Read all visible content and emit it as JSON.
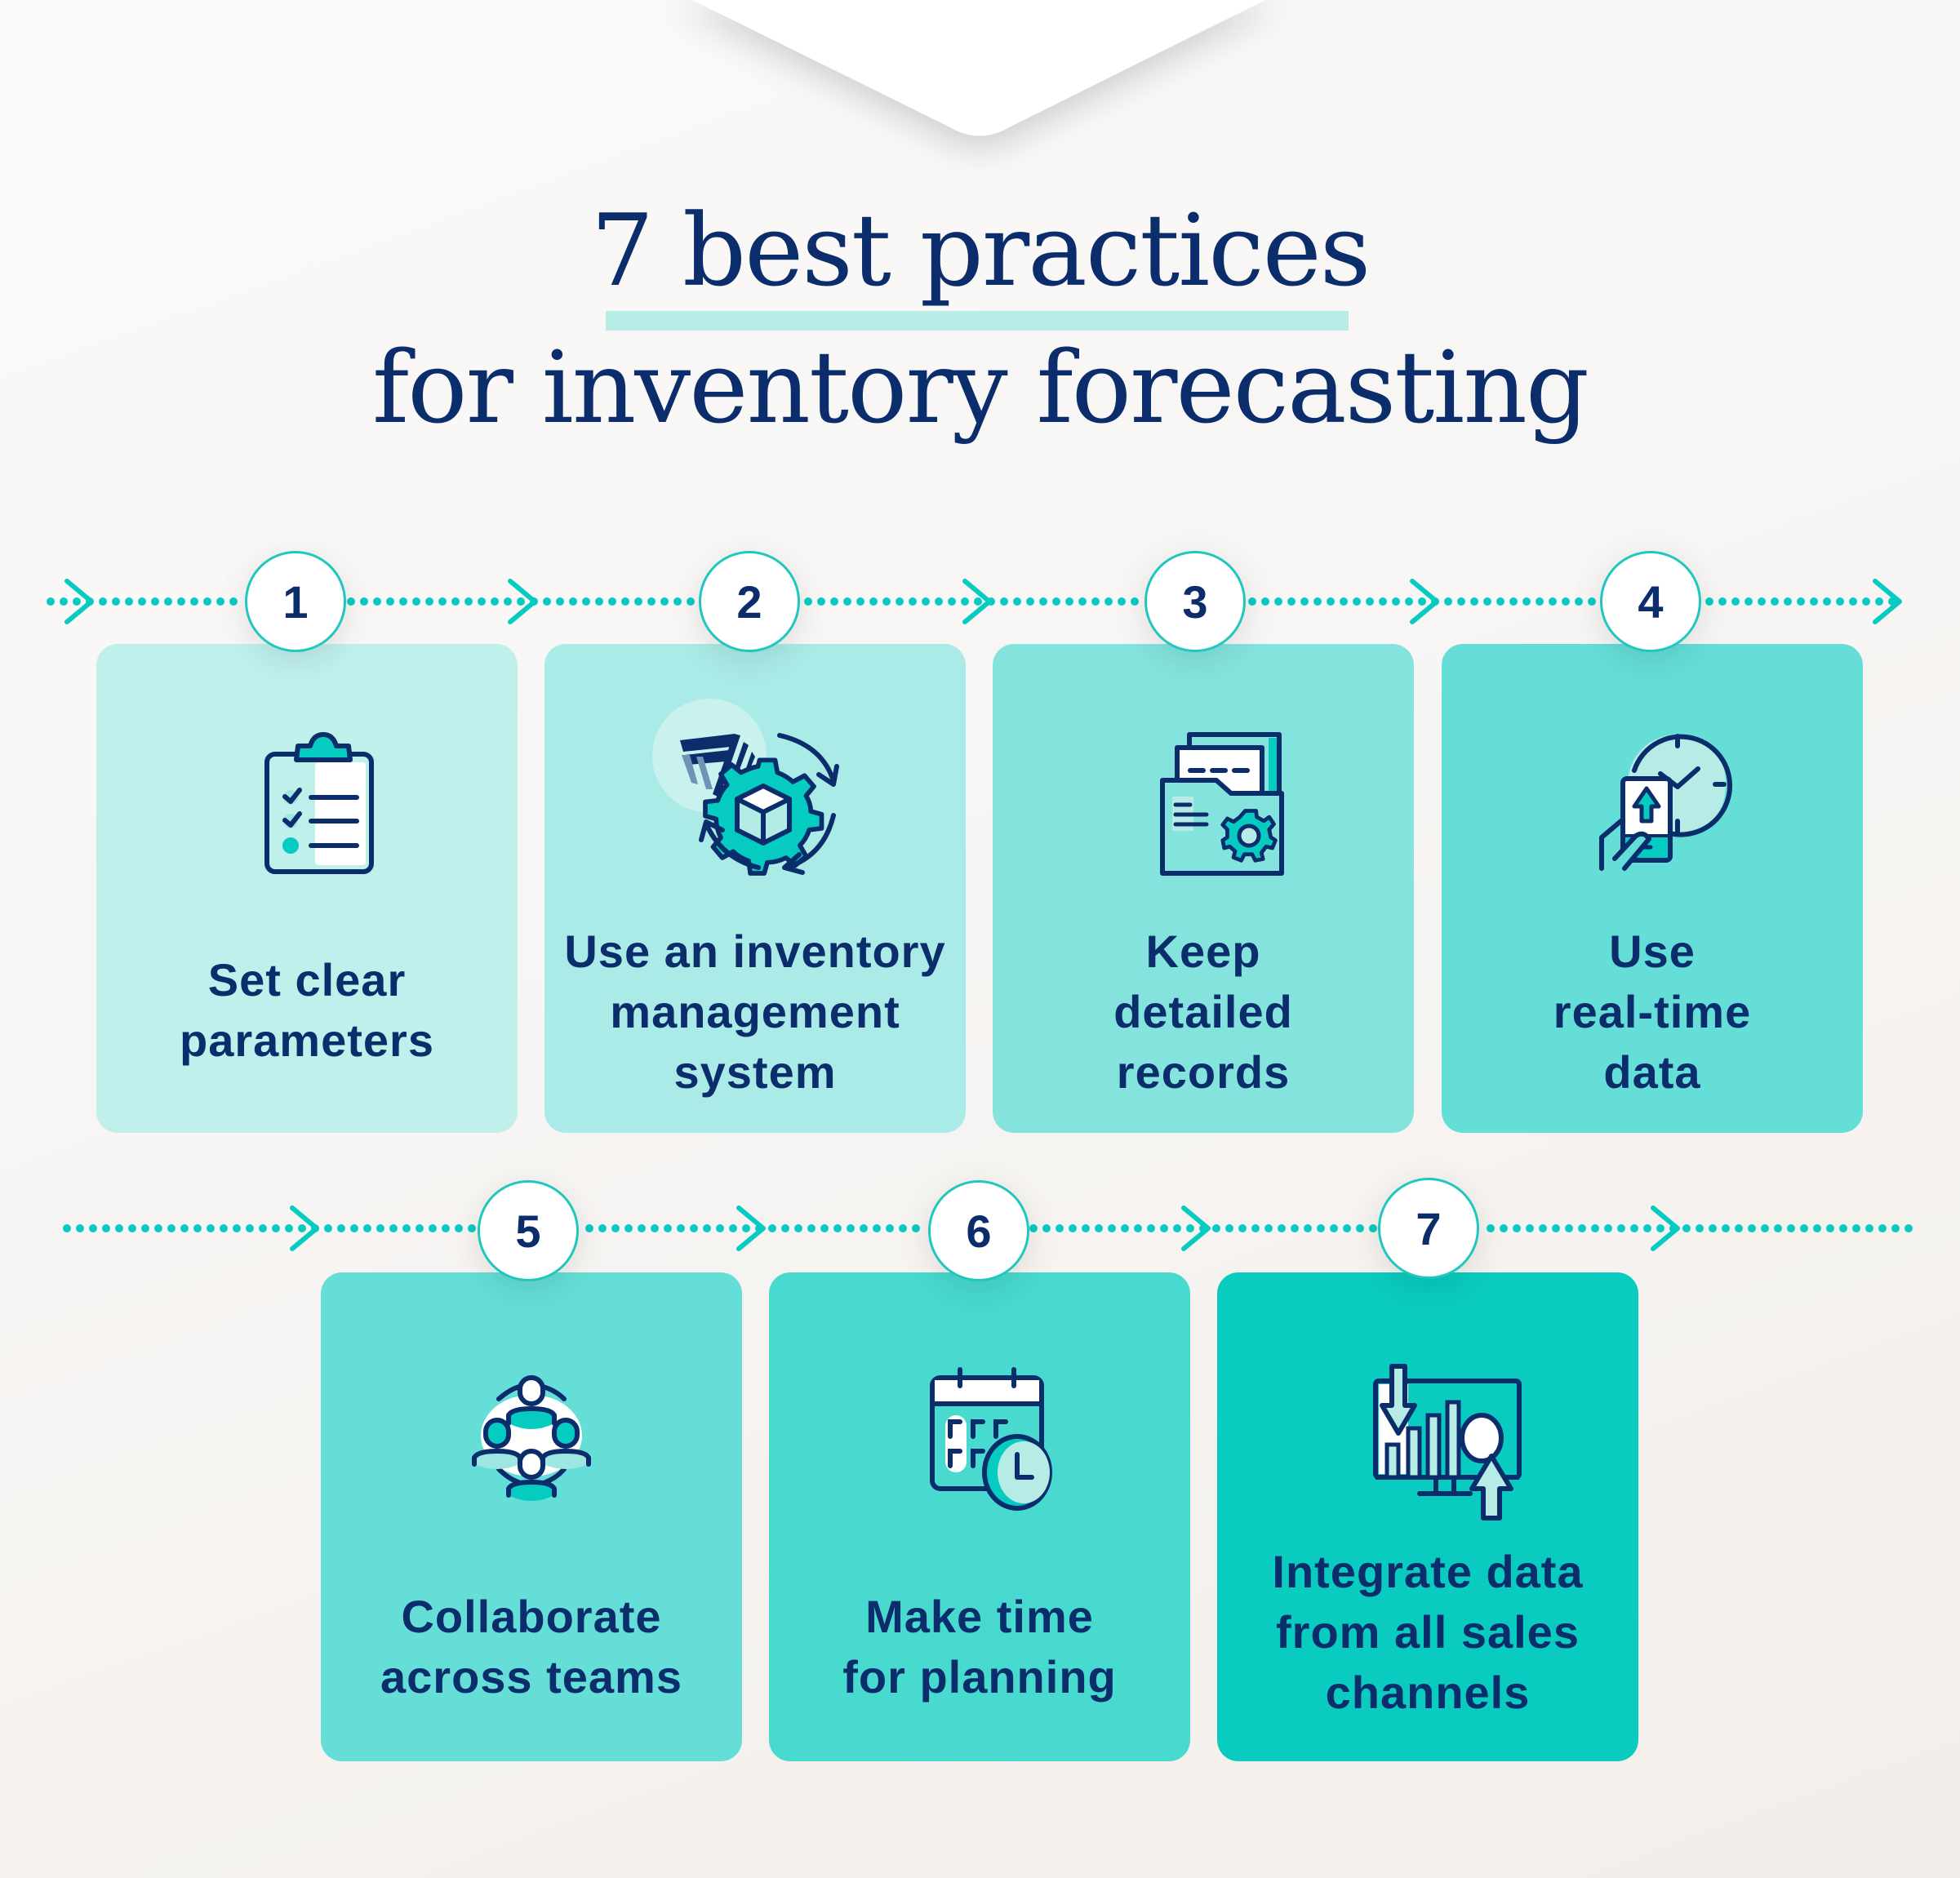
{
  "header": {
    "title_line_1": "7 best practices",
    "title_line_2": "for inventory forecasting"
  },
  "colors": {
    "navy": "#0b2d6b",
    "teal": "#06cbc0",
    "underline": "#b6ebe6",
    "card_1": "#c0f0ec",
    "card_2": "#aaebe7",
    "card_3": "#84e3dd",
    "card_4": "#64ded6",
    "card_5": "#64ded6",
    "card_6": "#48d9cf",
    "card_7": "#0acbc0"
  },
  "steps": [
    {
      "number": "1",
      "icon": "clipboard-checklist-icon",
      "label_lines": [
        "Set clear",
        "parameters"
      ]
    },
    {
      "number": "2",
      "icon": "inventory-system-gear-icon",
      "label_lines": [
        "Use an inventory",
        "management",
        "system"
      ]
    },
    {
      "number": "3",
      "icon": "folder-records-gear-icon",
      "label_lines": [
        "Keep",
        "detailed",
        "records"
      ]
    },
    {
      "number": "4",
      "icon": "phone-clock-realtime-icon",
      "label_lines": [
        "Use",
        "real-time",
        "data"
      ]
    },
    {
      "number": "5",
      "icon": "team-collaboration-icon",
      "label_lines": [
        "Collaborate",
        "across teams"
      ]
    },
    {
      "number": "6",
      "icon": "calendar-clock-icon",
      "label_lines": [
        "Make time",
        "for planning"
      ]
    },
    {
      "number": "7",
      "icon": "monitor-chart-arrows-icon",
      "label_lines": [
        "Integrate data",
        "from all sales",
        "channels"
      ]
    }
  ]
}
